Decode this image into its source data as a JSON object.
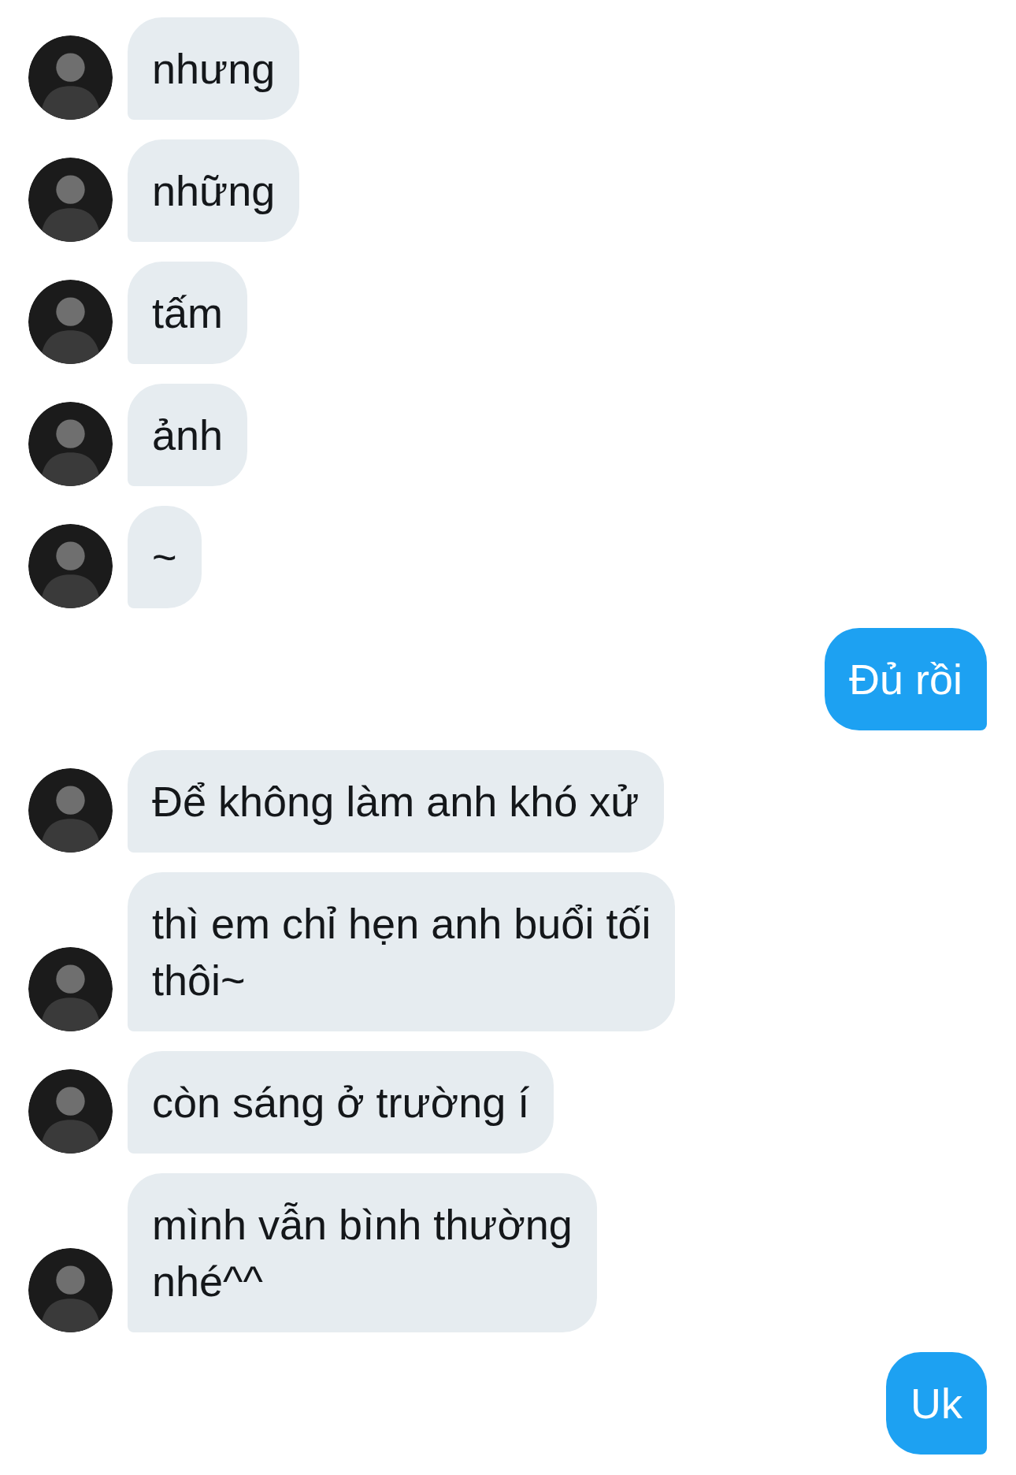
{
  "messages": [
    {
      "kind": "received",
      "text": "nhưng"
    },
    {
      "kind": "received",
      "text": "những"
    },
    {
      "kind": "received",
      "text": "tấm"
    },
    {
      "kind": "received",
      "text": "ảnh"
    },
    {
      "kind": "received",
      "text": "~"
    },
    {
      "kind": "sent",
      "text": "Đủ rồi"
    },
    {
      "kind": "received",
      "text": "Để không làm anh khó xử"
    },
    {
      "kind": "received",
      "text": "thì em chỉ hẹn anh buổi tối\nthôi~"
    },
    {
      "kind": "received",
      "text": "còn sáng ở trường í"
    },
    {
      "kind": "received",
      "text": "mình vẫn bình thường\nnhé^^"
    },
    {
      "kind": "sent",
      "text": "Uk"
    }
  ]
}
